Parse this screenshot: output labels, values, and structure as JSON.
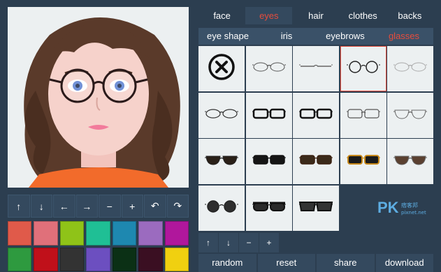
{
  "category_tabs": [
    {
      "label": "face",
      "active": false
    },
    {
      "label": "eyes",
      "active": true
    },
    {
      "label": "hair",
      "active": false
    },
    {
      "label": "clothes",
      "active": false
    },
    {
      "label": "backs",
      "active": false
    }
  ],
  "sub_tabs": [
    {
      "label": "eye shape",
      "active": false
    },
    {
      "label": "iris",
      "active": false
    },
    {
      "label": "eyebrows",
      "active": false
    },
    {
      "label": "glasses",
      "active": true
    }
  ],
  "left_tools": [
    {
      "icon": "arrow-up-icon",
      "glyph": "↑"
    },
    {
      "icon": "arrow-down-icon",
      "glyph": "↓"
    },
    {
      "icon": "arrow-left-icon",
      "glyph": "←"
    },
    {
      "icon": "arrow-right-icon",
      "glyph": "→"
    },
    {
      "icon": "zoom-out-icon",
      "glyph": "−"
    },
    {
      "icon": "zoom-in-icon",
      "glyph": "+"
    },
    {
      "icon": "rotate-left-icon",
      "glyph": "↶"
    },
    {
      "icon": "rotate-right-icon",
      "glyph": "↷"
    }
  ],
  "right_tools": [
    {
      "icon": "arrow-up-icon",
      "glyph": "↑"
    },
    {
      "icon": "arrow-down-icon",
      "glyph": "↓"
    },
    {
      "icon": "zoom-out-icon",
      "glyph": "−"
    },
    {
      "icon": "zoom-in-icon",
      "glyph": "+"
    }
  ],
  "palette": [
    "#e05a4a",
    "#e0707a",
    "#8fc318",
    "#1fbf95",
    "#1e88b0",
    "#9b6bbf",
    "#b0179c",
    "#2e9a3f",
    "#c0101a",
    "#333333",
    "#6c4fc0",
    "#0b3015",
    "#3a0f22",
    "#f0d010"
  ],
  "glasses": [
    {
      "id": "none",
      "icon": "no-glasses-icon",
      "selected": false
    },
    {
      "id": "g1",
      "icon": "thin-oval-glasses-icon",
      "selected": false
    },
    {
      "id": "g2",
      "icon": "rimless-glasses-icon",
      "selected": false
    },
    {
      "id": "g3",
      "icon": "round-glasses-icon",
      "selected": true
    },
    {
      "id": "g4",
      "icon": "light-glasses-icon",
      "selected": false
    },
    {
      "id": "g5",
      "icon": "oval-glasses-icon",
      "selected": false
    },
    {
      "id": "g6",
      "icon": "black-rect-glasses-icon",
      "selected": false
    },
    {
      "id": "g7",
      "icon": "black-square-glasses-icon",
      "selected": false
    },
    {
      "id": "g8",
      "icon": "half-rim-glasses-icon",
      "selected": false
    },
    {
      "id": "g9",
      "icon": "aviator-clear-glasses-icon",
      "selected": false
    },
    {
      "id": "s1",
      "icon": "dark-sunglasses-icon",
      "selected": false
    },
    {
      "id": "s2",
      "icon": "black-sunglasses-icon",
      "selected": false
    },
    {
      "id": "s3",
      "icon": "brown-sunglasses-icon",
      "selected": false
    },
    {
      "id": "s4",
      "icon": "gold-sunglasses-icon",
      "selected": false
    },
    {
      "id": "s5",
      "icon": "aviator-sunglasses-icon",
      "selected": false
    },
    {
      "id": "s6",
      "icon": "round-sunglasses-icon",
      "selected": false
    },
    {
      "id": "s7",
      "icon": "clubmaster-sunglasses-icon",
      "selected": false
    },
    {
      "id": "s8",
      "icon": "wayfarer-sunglasses-icon",
      "selected": false
    }
  ],
  "actions": [
    "random",
    "reset",
    "share",
    "download"
  ],
  "watermark": {
    "brand": "PK",
    "sub": "痞客邦",
    "url": "pixnet.net"
  }
}
